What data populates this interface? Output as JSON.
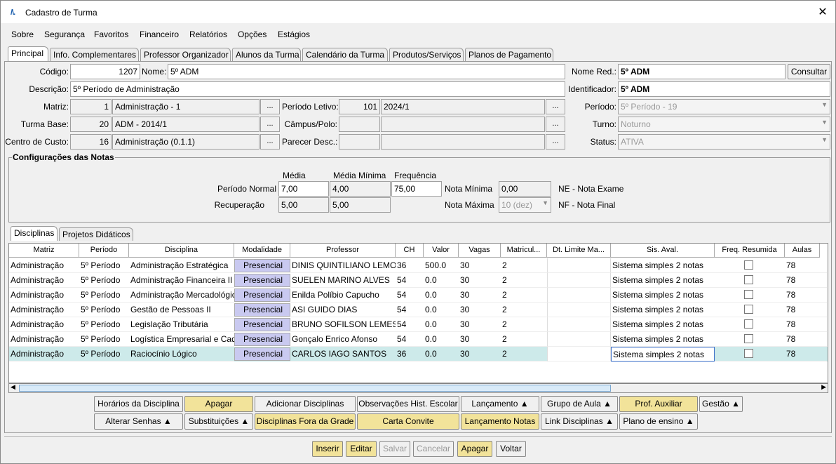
{
  "window": {
    "title": "Cadastro de Turma",
    "logo": "/\\."
  },
  "menu": [
    "Sobre",
    "Segurança",
    "Favoritos",
    "Financeiro",
    "Relatórios",
    "Opções",
    "Estágios"
  ],
  "tabs": [
    "Principal",
    "Info. Complementares",
    "Professor Organizador",
    "Alunos da Turma",
    "Calendário da Turma",
    "Produtos/Serviços",
    "Planos de Pagamento"
  ],
  "form": {
    "codigo_label": "Código:",
    "codigo": "1207",
    "nome_label": "Nome:",
    "nome": "5º ADM",
    "nome_red_label": "Nome Red.:",
    "nome_red": "5º ADM",
    "consultar": "Consultar",
    "descricao_label": "Descrição:",
    "descricao": "5º Período de Administração",
    "identificador_label": "Identificador:",
    "identificador": "5º ADM",
    "matriz_label": "Matriz:",
    "matriz_id": "1",
    "matriz": "Administração - 1",
    "periodo_letivo_label": "Período Letivo:",
    "periodo_letivo_id": "101",
    "periodo_letivo": "2024/1",
    "periodo_label": "Período:",
    "periodo": "5º Período - 19",
    "turma_base_label": "Turma Base:",
    "turma_base_id": "20",
    "turma_base": "ADM - 2014/1",
    "campus_label": "Câmpus/Polo:",
    "turno_label": "Turno:",
    "turno": "Noturno",
    "centro_custo_label": "Centro de Custo:",
    "centro_custo_id": "16",
    "centro_custo": "Administração (0.1.1)",
    "parecer_label": "Parecer Desc.:",
    "status_label": "Status:",
    "status": "ATIVA",
    "ellipsis": "..."
  },
  "notas": {
    "title": "Configurações das Notas",
    "h_media": "Média",
    "h_media_min": "Média Mínima",
    "h_freq": "Frequência",
    "periodo_normal_label": "Período Normal",
    "pn_media": "7,00",
    "pn_media_min": "4,00",
    "pn_freq": "75,00",
    "recuperacao_label": "Recuperação",
    "rec_media": "5,00",
    "rec_media_min": "5,00",
    "nota_minima_label": "Nota Mínima",
    "nota_minima": "0,00",
    "nota_maxima_label": "Nota Máxima",
    "nota_maxima": "10 (dez)",
    "ne": "NE - Nota Exame",
    "nf": "NF - Nota Final"
  },
  "subtabs": [
    "Disciplinas",
    "Projetos Didáticos"
  ],
  "grid": {
    "headers": [
      "Matriz",
      "Período",
      "Disciplina",
      "Modalidade",
      "Professor",
      "CH",
      "Valor",
      "Vagas",
      "Matricul...",
      "Dt. Limite Ma...",
      "Sis. Aval.",
      "Freq. Resumida",
      "Aulas"
    ],
    "rows": [
      [
        "Administração",
        "5º Período",
        "Administração Estratégica",
        "Presencial",
        "DINIS QUINTILIANO LEMOS",
        "36",
        "500.0",
        "30",
        "2",
        "",
        "Sistema simples 2 notas",
        "",
        "78"
      ],
      [
        "Administração",
        "5º Período",
        "Administração Financeira II",
        "Presencial",
        "SUELEN MARINO ALVES",
        "54",
        "0.0",
        "30",
        "2",
        "",
        "Sistema simples 2 notas",
        "",
        "78"
      ],
      [
        "Administração",
        "5º Período",
        "Administração Mercadológica",
        "Presencial",
        "Enilda Políbio Capucho",
        "54",
        "0.0",
        "30",
        "2",
        "",
        "Sistema simples 2 notas",
        "",
        "78"
      ],
      [
        "Administração",
        "5º Período",
        "Gestão de Pessoas II",
        "Presencial",
        "ASI GUIDO DIAS",
        "54",
        "0.0",
        "30",
        "2",
        "",
        "Sistema simples 2 notas",
        "",
        "78"
      ],
      [
        "Administração",
        "5º Período",
        "Legislação Tributária",
        "Presencial",
        "BRUNO SOFILSON LEMES",
        "54",
        "0.0",
        "30",
        "2",
        "",
        "Sistema simples 2 notas",
        "",
        "78"
      ],
      [
        "Administração",
        "5º Período",
        "Logística Empresarial e Cadeia",
        "Presencial",
        "Gonçalo Enrico Afonso",
        "54",
        "0.0",
        "30",
        "2",
        "",
        "Sistema simples 2 notas",
        "",
        "78"
      ],
      [
        "Administração",
        "5º Período",
        "Raciocínio Lógico",
        "Presencial",
        "CARLOS IAGO SANTOS",
        "36",
        "0.0",
        "30",
        "2",
        "",
        "Sistema simples 2 notas",
        "",
        "78"
      ]
    ]
  },
  "buttons_row1": [
    "Horários da Disciplina",
    "Apagar",
    "Adicionar Disciplinas",
    "Observações Hist. Escolar",
    "Lançamento ▲",
    "Grupo de Aula ▲",
    "Prof. Auxiliar",
    "Gestão ▲"
  ],
  "buttons_row2": [
    "Alterar Senhas ▲",
    "Substituições ▲",
    "Disciplinas Fora da Grade",
    "Carta Convite",
    "Lançamento Notas",
    "Link Disciplinas ▲",
    "Plano de ensino ▲"
  ],
  "bottom_buttons": [
    "Inserir",
    "Editar",
    "Salvar",
    "Cancelar",
    "Apagar",
    "Voltar"
  ]
}
